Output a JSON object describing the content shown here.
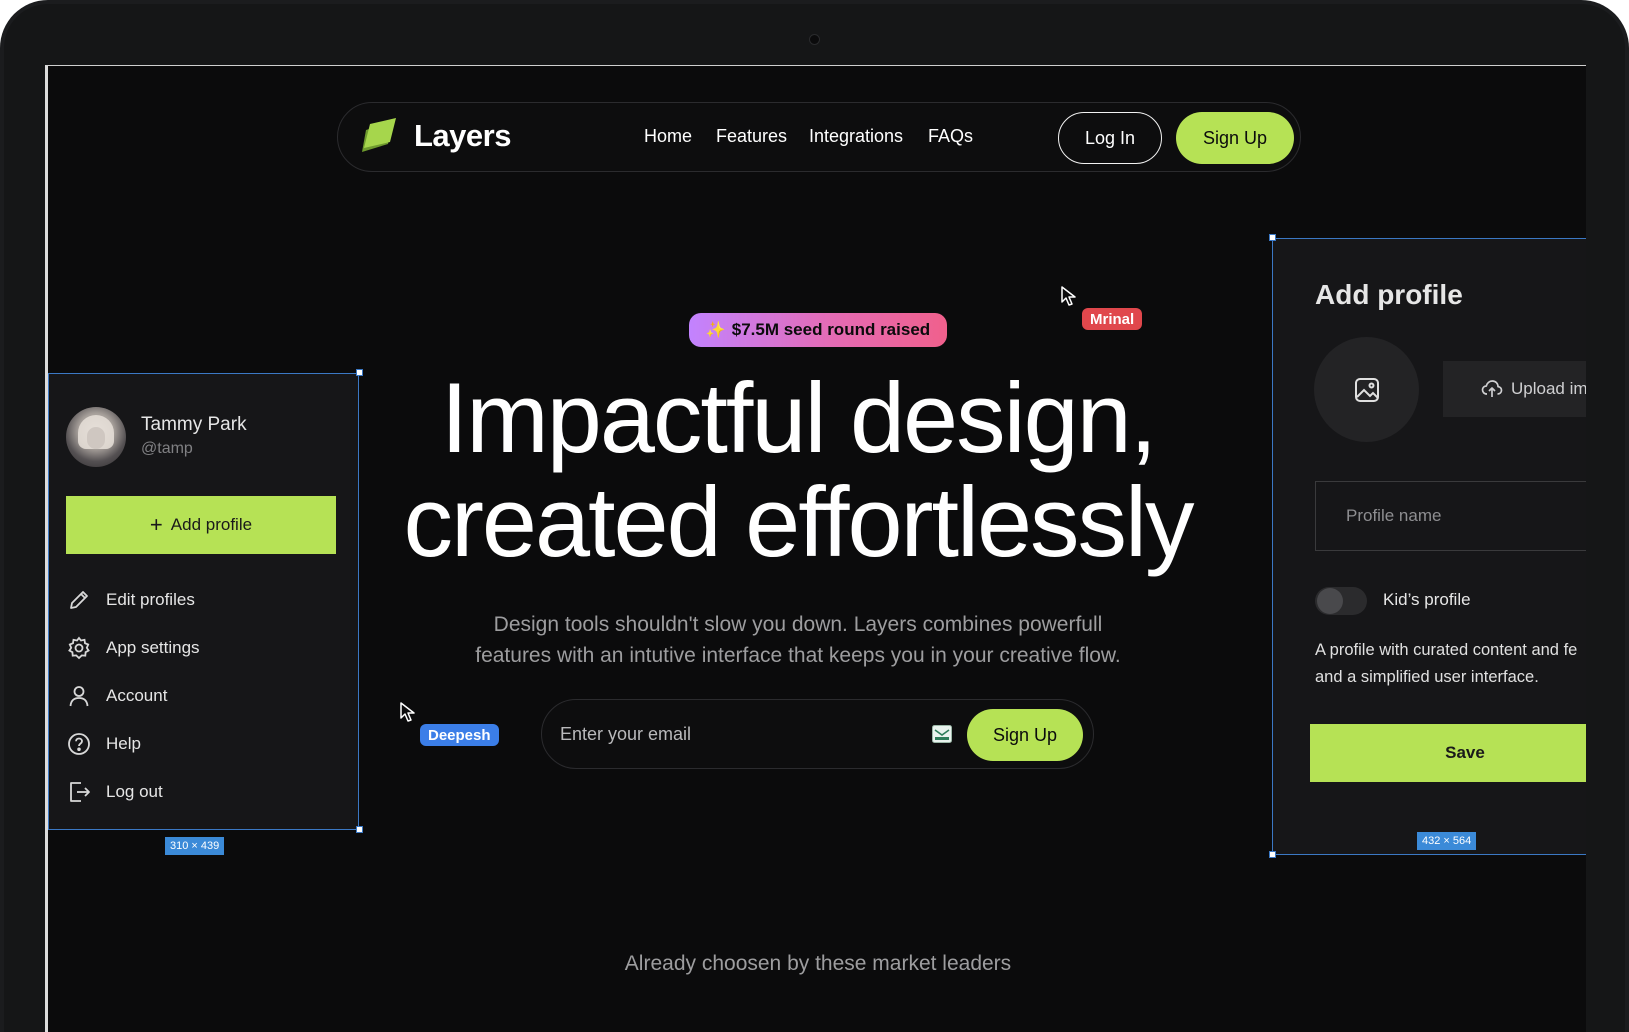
{
  "nav": {
    "brand": "Layers",
    "links": [
      "Home",
      "Features",
      "Integrations",
      "FAQs"
    ],
    "login_label": "Log In",
    "signup_label": "Sign Up"
  },
  "hero": {
    "badge_icon": "sparkle-icon",
    "badge_text": "$7.5M seed round raised",
    "title_line1": "Impactful design,",
    "title_line2": "created effortlessly",
    "subtitle_line1": "Design tools shouldn't slow you down. Layers combines powerfull",
    "subtitle_line2": "features with an intutive interface that keeps you in your creative flow.",
    "email_placeholder": "Enter your email",
    "signup_label": "Sign Up",
    "leaders_text": "Already choosen by these market leaders"
  },
  "cursors": [
    {
      "name": "Mrinal",
      "color": "#e0474c"
    },
    {
      "name": "Deepesh",
      "color": "#3b7ee8"
    }
  ],
  "left_panel": {
    "user_name": "Tammy Park",
    "user_handle": "@tamp",
    "add_profile_label": "Add profile",
    "menu": [
      {
        "label": "Edit profiles",
        "icon": "pencil-icon"
      },
      {
        "label": "App settings",
        "icon": "gear-icon"
      },
      {
        "label": "Account",
        "icon": "user-icon"
      },
      {
        "label": "Help",
        "icon": "help-icon"
      },
      {
        "label": "Log out",
        "icon": "logout-icon"
      }
    ],
    "dimensions": "310 × 439"
  },
  "right_panel": {
    "title": "Add profile",
    "upload_label": "Upload im",
    "profile_name_placeholder": "Profile name",
    "kids_label": "Kid’s profile",
    "kids_toggle_on": false,
    "desc_line1": "A profile with curated content and fe",
    "desc_line2": "and a simplified user interface.",
    "save_label": "Save",
    "dimensions": "432 × 564"
  },
  "colors": {
    "accent": "#b6e255",
    "background": "#0b0b0c",
    "panel": "#161618",
    "selection": "#3b78c4"
  }
}
